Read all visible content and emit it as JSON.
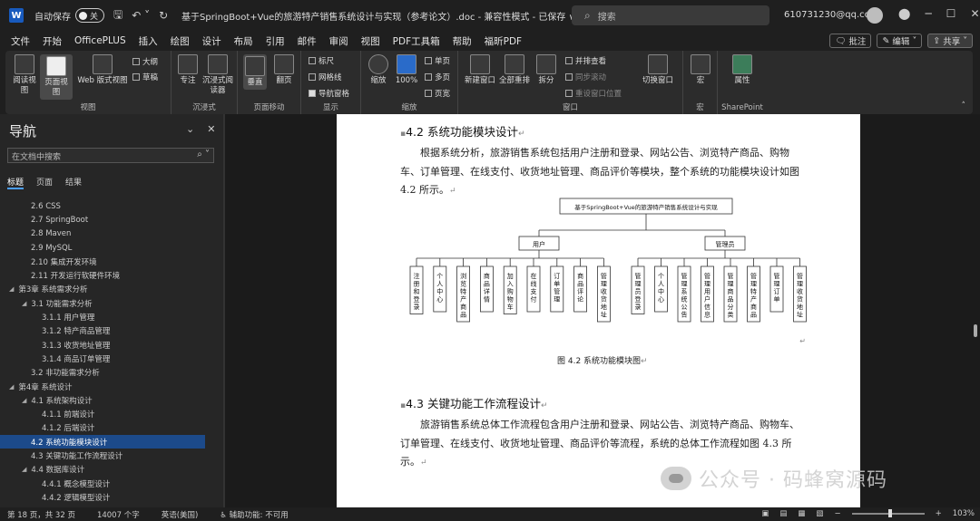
{
  "titlebar": {
    "word_icon": "W",
    "autosave_label": "自动保存",
    "autosave_state": "关",
    "doc_title": "基于SpringBoot+Vue的旅游特产销售系统设计与实现（参考论文）.doc - 兼容性模式 - 已保存 ∨",
    "search_placeholder": "搜索",
    "email": "610731230@qq.com"
  },
  "menubar": {
    "tabs": [
      "文件",
      "开始",
      "OfficePLUS",
      "插入",
      "绘图",
      "设计",
      "布局",
      "引用",
      "邮件",
      "审阅",
      "视图",
      "PDF工具箱",
      "帮助",
      "福昕PDF"
    ],
    "active": "视图",
    "comment_btn": "批注",
    "edit_btn": "编辑",
    "share_btn": "共享"
  },
  "ribbon": {
    "views": {
      "read": "阅读视图",
      "print": "页面视图",
      "web": "Web 版式视图",
      "outline": "大纲",
      "draft": "草稿",
      "group": "视图"
    },
    "immersive": {
      "focus": "专注",
      "reader": "沉浸式阅读器",
      "group": "沉浸式"
    },
    "page_move": {
      "vertical": "垂直",
      "side": "翻页",
      "group": "页面移动"
    },
    "show": {
      "ruler": "标尺",
      "gridlines": "网格线",
      "nav_pane": "导航窗格",
      "group": "显示"
    },
    "zoom": {
      "zoom": "缩放",
      "hundred": "100%",
      "one_page": "单页",
      "multi_page": "多页",
      "page_width": "页宽",
      "group": "缩放"
    },
    "window": {
      "new_window": "新建窗口",
      "arrange_all": "全部重排",
      "split": "拆分",
      "side_by_side": "并排查看",
      "sync_scroll": "同步滚动",
      "reset_pos": "重设窗口位置",
      "switch_window": "切换窗口",
      "group": "窗口"
    },
    "macros": {
      "label": "宏",
      "group": "宏"
    },
    "sharepoint": {
      "label": "属性",
      "group": "SharePoint"
    }
  },
  "nav": {
    "title": "导航",
    "search_placeholder": "在文档中搜索",
    "tabs": [
      "标题",
      "页面",
      "结果"
    ],
    "items": [
      {
        "label": "2.6 CSS",
        "indent": 2,
        "arrow": ""
      },
      {
        "label": "2.7 SpringBoot",
        "indent": 2,
        "arrow": ""
      },
      {
        "label": "2.8  Maven",
        "indent": 2,
        "arrow": ""
      },
      {
        "label": "2.9 MySQL",
        "indent": 2,
        "arrow": ""
      },
      {
        "label": "2.10  集成开发环境",
        "indent": 2,
        "arrow": ""
      },
      {
        "label": "2.11  开发运行软硬件环境",
        "indent": 2,
        "arrow": ""
      },
      {
        "label": "第3章 系统需求分析",
        "indent": 0,
        "arrow": "◢"
      },
      {
        "label": "3.1  功能需求分析",
        "indent": 1,
        "arrow": "◢"
      },
      {
        "label": "3.1.1  用户管理",
        "indent": 3,
        "arrow": ""
      },
      {
        "label": "3.1.2  特产商品管理",
        "indent": 3,
        "arrow": ""
      },
      {
        "label": "3.1.3  收货地址管理",
        "indent": 3,
        "arrow": ""
      },
      {
        "label": "3.1.4  商品订单管理",
        "indent": 3,
        "arrow": ""
      },
      {
        "label": "3.2  非功能需求分析",
        "indent": 2,
        "arrow": ""
      },
      {
        "label": "第4章 系统设计",
        "indent": 0,
        "arrow": "◢"
      },
      {
        "label": "4.1  系统架构设计",
        "indent": 1,
        "arrow": "◢"
      },
      {
        "label": "4.1.1  前端设计",
        "indent": 3,
        "arrow": ""
      },
      {
        "label": "4.1.2  后端设计",
        "indent": 3,
        "arrow": ""
      },
      {
        "label": "4.2  系统功能模块设计",
        "indent": 2,
        "arrow": "",
        "selected": true
      },
      {
        "label": "4.3  关键功能工作流程设计",
        "indent": 2,
        "arrow": ""
      },
      {
        "label": "4.4  数据库设计",
        "indent": 1,
        "arrow": "◢"
      },
      {
        "label": "4.4.1  概念模型设计",
        "indent": 3,
        "arrow": ""
      },
      {
        "label": "4.4.2  逻辑模型设计",
        "indent": 3,
        "arrow": ""
      }
    ]
  },
  "document": {
    "h42": "4.2   系统功能模块设计",
    "para1": "根据系统分析，旅游销售系统包括用户注册和登录、网站公告、浏览特产商品、购物车、订单管理、在线支付、收货地址管理、商品评价等模块，整个系统的功能模块设计如图 4.2 所示。",
    "diagram": {
      "root": "基于SpringBoot+Vue的旅游特产销售系统设计与实现",
      "user": "用户",
      "admin": "管理员",
      "user_leaves": [
        "注册和登录",
        "个人中心",
        "浏览特产商品",
        "商品详情",
        "加入购物车",
        "在线支付",
        "订单管理",
        "商品评论",
        "管理收货地址"
      ],
      "admin_leaves": [
        "管理员登录",
        "个人中心",
        "管理系统公告",
        "管理用户信息",
        "管理商品分类",
        "管理特产商品",
        "管理订单",
        "管理收货地址"
      ]
    },
    "caption": "图 4.2  系统功能模块图",
    "h43": "4.3   关键功能工作流程设计",
    "para2": "旅游销售系统总体工作流程包含用户注册和登录、网站公告、浏览特产商品、购物车、订单管理、在线支付、收货地址管理、商品评价等流程，系统的总体工作流程如图 4.3 所示。",
    "para_mark": "↵"
  },
  "watermark": "公众号 · 码蜂窝源码",
  "status": {
    "page": "第 18 页，共 32 页",
    "words": "14007 个字",
    "lang": "英语(美国)",
    "accessibility": "辅助功能: 不可用",
    "zoom": "103%"
  }
}
